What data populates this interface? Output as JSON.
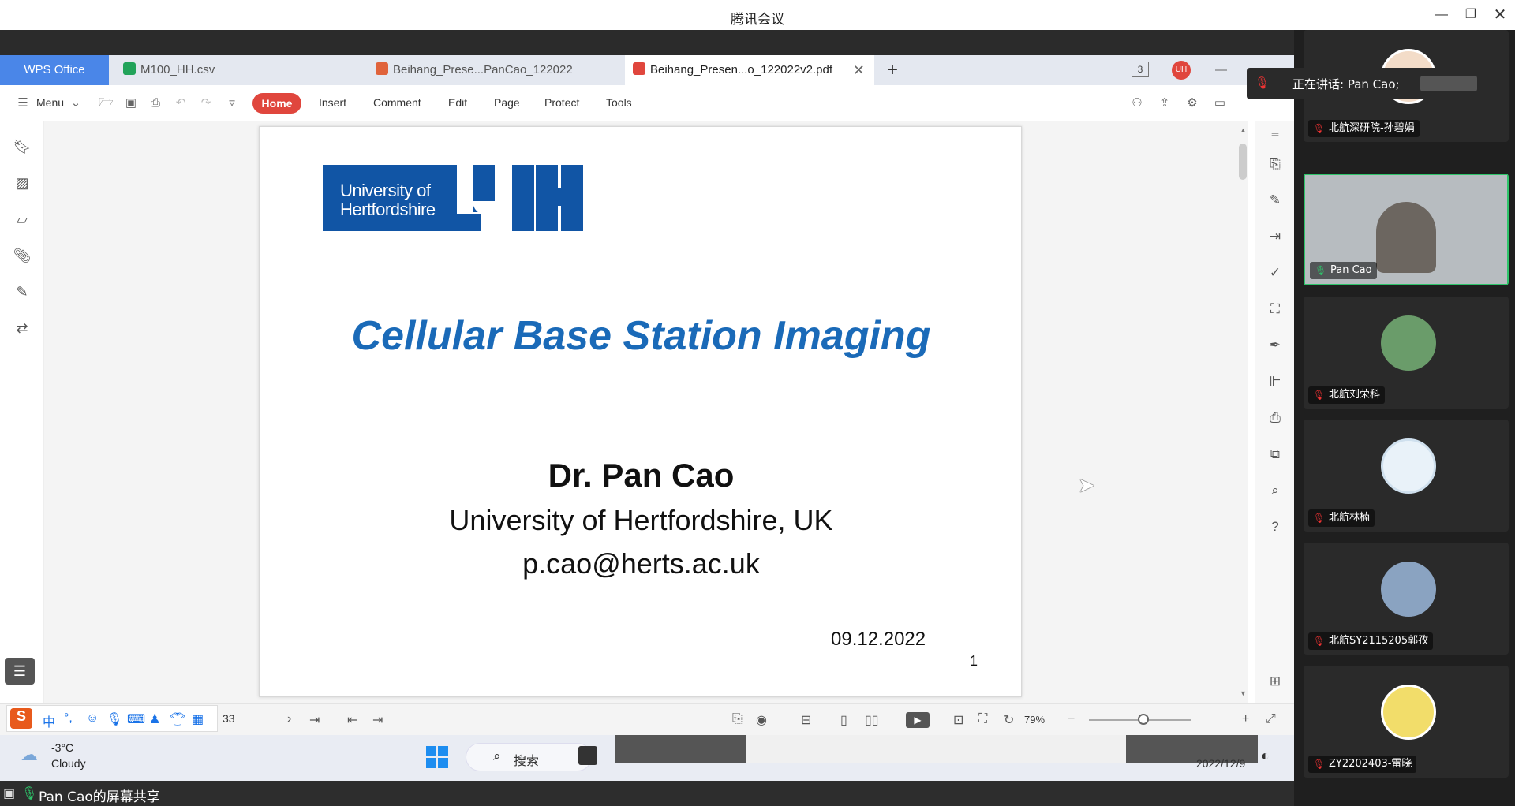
{
  "window": {
    "title": "腾讯会议"
  },
  "wps": {
    "home_label": "WPS Office",
    "tabs": [
      {
        "label": "M100_HH.csv",
        "color": "#22a35a"
      },
      {
        "label": "Beihang_Prese...PanCao_122022",
        "color": "#e0633b"
      },
      {
        "label": "Beihang_Presen...o_122022v2.pdf",
        "color": "#e0463d"
      }
    ],
    "tab_count": "3",
    "user_initials": "UH"
  },
  "toolbar": {
    "menu_label": "Menu",
    "items": [
      "Home",
      "Insert",
      "Comment",
      "Edit",
      "Page",
      "Protect",
      "Tools"
    ]
  },
  "slide": {
    "logo_text_line1": "University of",
    "logo_text_line2": "Hertfordshire",
    "title": "Cellular Base Station Imaging",
    "author": "Dr. Pan Cao",
    "affiliation": "University of Hertfordshire, UK",
    "email": "p.cao@herts.ac.uk",
    "date": "09.12.2022",
    "page_number": "1"
  },
  "status": {
    "page_input": "33",
    "zoom": "79%"
  },
  "taskbar": {
    "weather_temp": "-3°C",
    "weather_desc": "Cloudy",
    "search_label": "搜索",
    "date": "2022/12/9"
  },
  "share_banner": "Pan Cao的屏幕共享",
  "meeting": {
    "speaking_label": "正在讲话: Pan Cao;",
    "participants": [
      {
        "name": "北航深研院-孙碧娟",
        "muted": true
      },
      {
        "name": "Pan Cao",
        "muted": false
      },
      {
        "name": "北航刘荣科",
        "muted": true
      },
      {
        "name": "北航林楠",
        "muted": true
      },
      {
        "name": "北航SY2115205郭孜",
        "muted": true
      },
      {
        "name": "ZY2202403-雷晓",
        "muted": true
      }
    ]
  },
  "colors": {
    "wps_accent": "#4a86e8",
    "home_pill": "#e0463d",
    "slide_title": "#1a6ab8",
    "uh_blue": "#1155a5",
    "active_speaker_border": "#2ec46a"
  }
}
